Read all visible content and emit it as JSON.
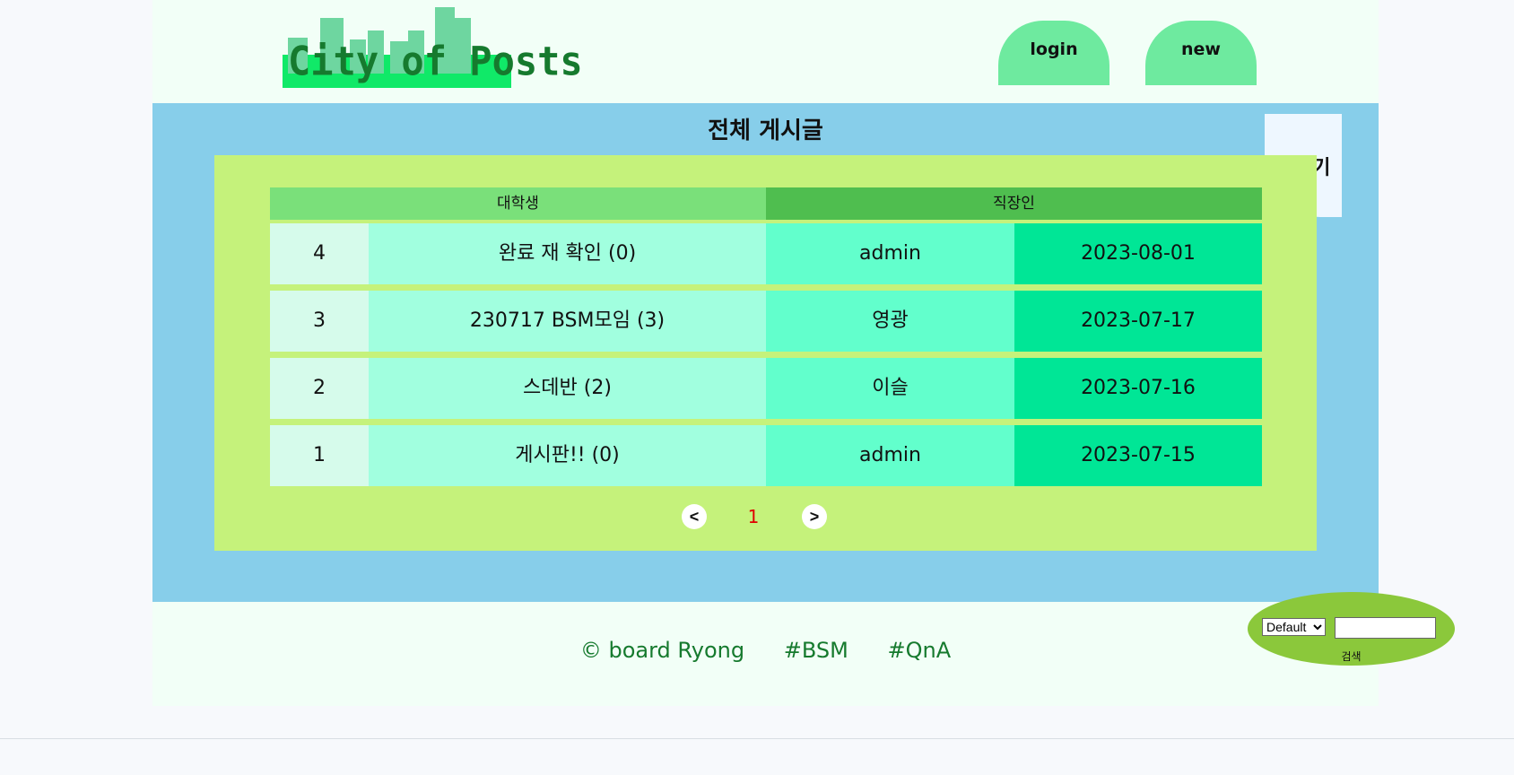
{
  "header": {
    "logo_text": "City of Posts",
    "login_label": "login",
    "new_label": "new"
  },
  "main": {
    "title": "전체 게시글",
    "write_label": "글쓰기",
    "col_headers": [
      "대학생",
      "직장인"
    ],
    "rows": [
      {
        "num": "4",
        "title": "완료 재 확인 (0)",
        "author": "admin",
        "date": "2023-08-01"
      },
      {
        "num": "3",
        "title": "230717 BSM모임 (3)",
        "author": "영광",
        "date": "2023-07-17"
      },
      {
        "num": "2",
        "title": "스데반 (2)",
        "author": "이슬",
        "date": "2023-07-16"
      },
      {
        "num": "1",
        "title": "게시판!! (0)",
        "author": "admin",
        "date": "2023-07-15"
      }
    ],
    "pager": {
      "prev": "<",
      "current": "1",
      "next": ">"
    }
  },
  "footer": {
    "copyright": "© board Ryong",
    "tag1": "#BSM",
    "tag2": "#QnA"
  },
  "search": {
    "select_value": "Default",
    "input_value": "",
    "button_label": "검색"
  },
  "colors": {
    "main_bg": "#87ceea",
    "inner_bg": "#c5f27b",
    "header_button": "#6eea9f",
    "footer_text": "#167a2e",
    "current_page": "#e00000"
  }
}
